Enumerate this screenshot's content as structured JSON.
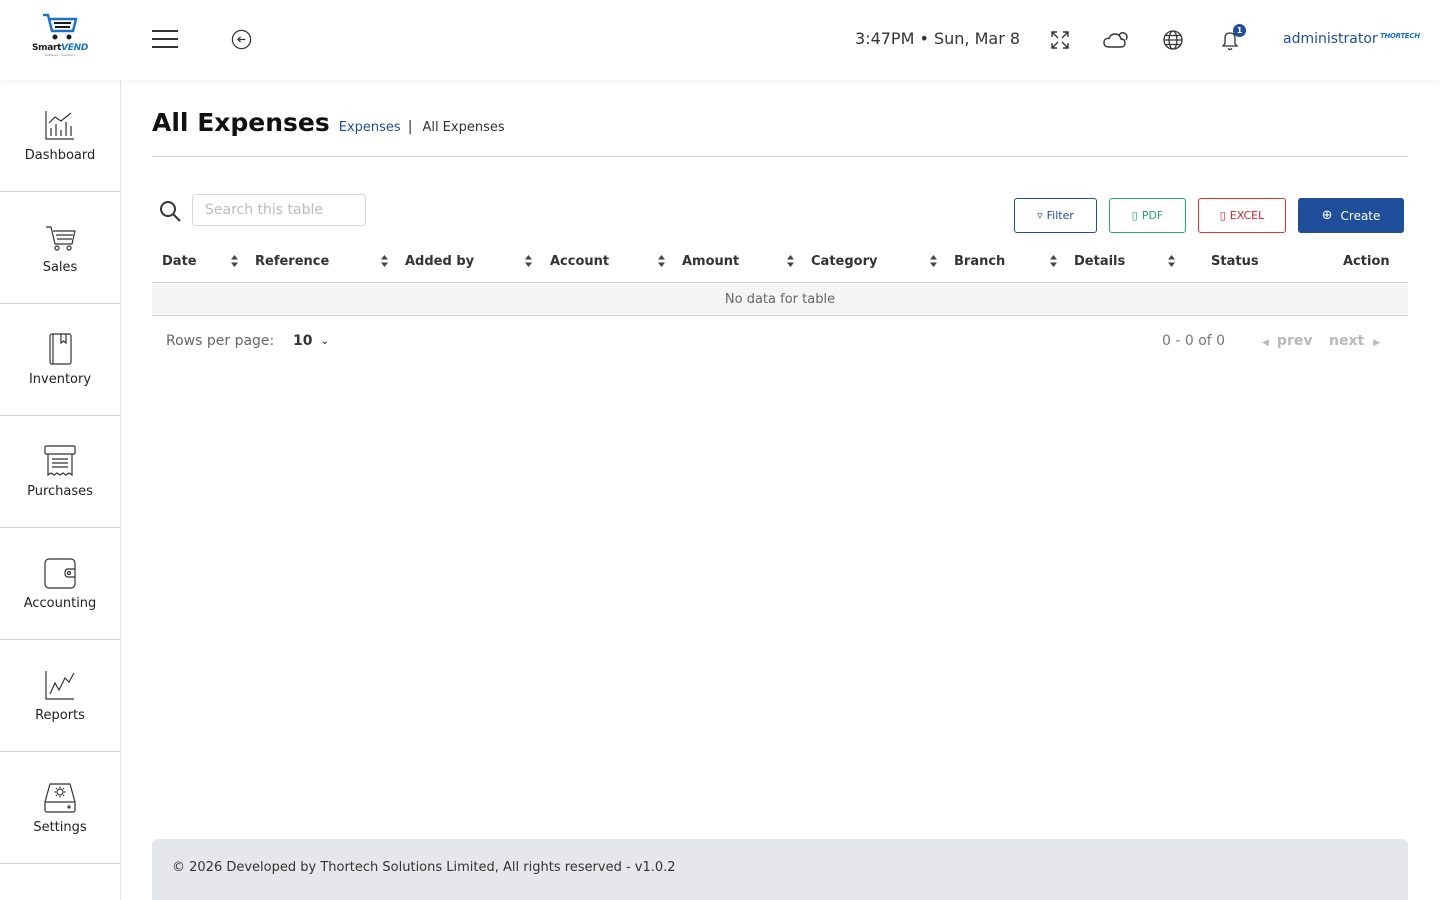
{
  "brand": {
    "logo_text": "Smart",
    "logo_text_accent": "VEND",
    "logo_sub": "Software · Inventory",
    "accent_color": "#1f4f9b"
  },
  "header": {
    "datetime": "3:47PM • Sun, Mar 8",
    "notifications_count": "1",
    "user_name": "administrator",
    "user_logo": "THORTECH",
    "icons": [
      "fullscreen-icon",
      "weather-icon",
      "globe-icon",
      "bell-icon"
    ]
  },
  "sidebar": {
    "items": [
      {
        "label": "Dashboard",
        "icon": "dashboard-icon"
      },
      {
        "label": "Sales",
        "icon": "cart-icon"
      },
      {
        "label": "Inventory",
        "icon": "book-icon"
      },
      {
        "label": "Purchases",
        "icon": "receipt-icon"
      },
      {
        "label": "Accounting",
        "icon": "wallet-icon"
      },
      {
        "label": "Reports",
        "icon": "chart-icon"
      },
      {
        "label": "Settings",
        "icon": "gear-icon"
      }
    ]
  },
  "page": {
    "title": "All Expenses",
    "breadcrumb": {
      "parent": "Expenses",
      "separator": "|",
      "current": "All Expenses"
    }
  },
  "toolbar": {
    "search_placeholder": "Search this table",
    "filter_label": "Filter",
    "pdf_label": "PDF",
    "excel_label": "EXCEL",
    "create_label": "Create"
  },
  "table": {
    "columns": [
      "Date",
      "Reference",
      "Added by",
      "Account",
      "Amount",
      "Category",
      "Branch",
      "Details",
      "Status",
      "Action"
    ],
    "empty_message": "No data for table"
  },
  "pagination": {
    "rows_per_page_label": "Rows per page:",
    "rows_per_page_value": "10",
    "range": "0 - 0 of 0",
    "prev_label": "prev",
    "next_label": "next"
  },
  "footer": {
    "text": "© 2026 Developed by Thortech Solutions Limited, All rights reserved - v1.0.2"
  }
}
